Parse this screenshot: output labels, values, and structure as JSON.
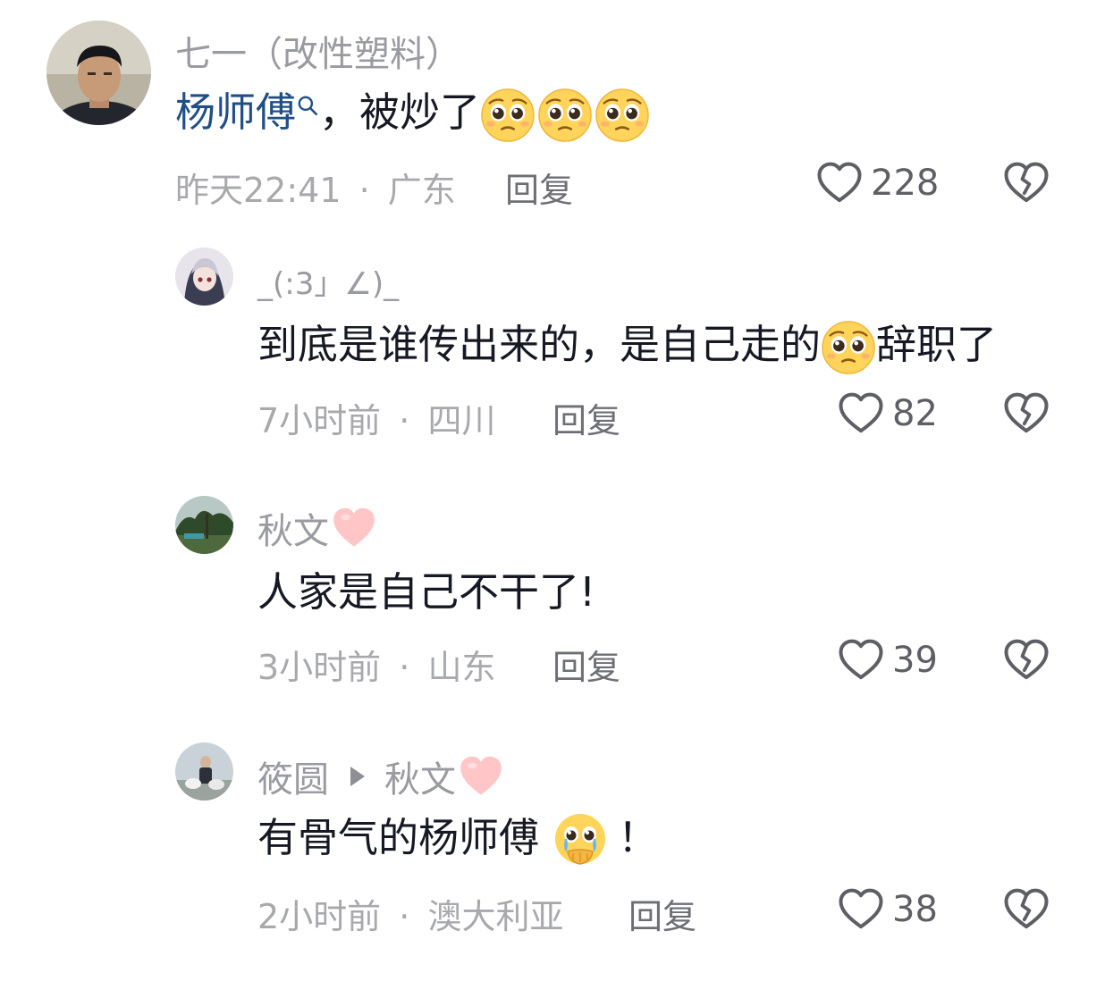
{
  "comments": [
    {
      "username": "七一（改性塑料）",
      "content_link": "杨师傅",
      "content_after": "，被炒了",
      "time": "昨天22:41",
      "location": "广东",
      "reply_label": "回复",
      "likes": "228"
    }
  ],
  "replies": [
    {
      "username": "_(:3」∠)_",
      "content_before": "到底是谁传出来的，是自己走的",
      "content_after": "辞职了",
      "time": "7小时前",
      "location": "四川",
      "reply_label": "回复",
      "likes": "82"
    },
    {
      "username": "秋文",
      "content": "人家是自己不干了!",
      "time": "3小时前",
      "location": "山东",
      "reply_label": "回复",
      "likes": "39"
    },
    {
      "username": "筱圆",
      "reply_to": "秋文",
      "content_before": "有骨气的杨师傅",
      "content_after": "！",
      "time": "2小时前",
      "location": "澳大利亚",
      "reply_label": "回复",
      "likes": "38"
    }
  ],
  "separator": "·",
  "icons": {
    "search": "search-icon",
    "like": "heart-outline-icon",
    "dislike": "broken-heart-icon",
    "pleading": "pleading-face-emoji",
    "crying": "holding-back-tears-emoji",
    "heart": "pink-heart-emoji"
  },
  "colors": {
    "link": "#1f4f86",
    "meta": "#a8a9ad",
    "name": "#9a9ba0",
    "text": "#161823"
  }
}
